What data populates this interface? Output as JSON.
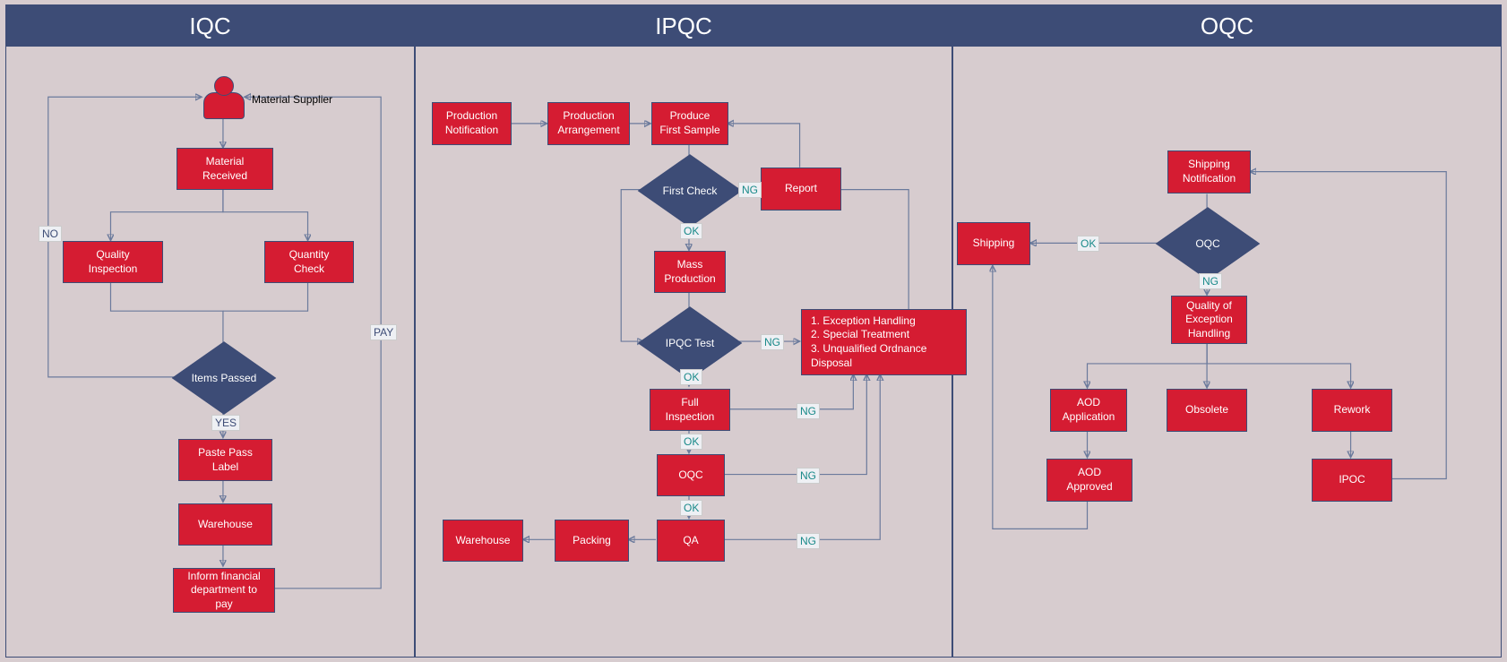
{
  "lanes": {
    "iqc": {
      "title": "IQC"
    },
    "ipqc": {
      "title": "IPQC"
    },
    "oqc": {
      "title": "OQC"
    }
  },
  "iqc": {
    "actor_label": "Material Supplier",
    "material_received": "Material Received",
    "quality_inspection": "Quality Inspection",
    "quantity_check": "Quantity Check",
    "items_passed": "Items Passed",
    "paste_pass_label": "Paste Pass Label",
    "warehouse": "Warehouse",
    "inform_pay": "Inform financial department to pay",
    "edge_no": "NO",
    "edge_yes": "YES",
    "edge_pay": "PAY"
  },
  "ipqc": {
    "production_notification": "Production Notification",
    "production_arrangement": "Production Arrangement",
    "produce_first_sample": "Produce First Sample",
    "first_check": "First Check",
    "report": "Report",
    "mass_production": "Mass Production",
    "ipqc_test": "IPQC Test",
    "exception_text": "1. Exception Handling\n2. Special Treatment\n3. Unqualified Ordnance Disposal",
    "full_inspection": "Full Inspection",
    "oqc": "OQC",
    "qa": "QA",
    "packing": "Packing",
    "warehouse": "Warehouse",
    "edge_ok": "OK",
    "edge_ng": "NG"
  },
  "oqc": {
    "shipping_notification": "Shipping Notification",
    "oqc_decision": "OQC",
    "shipping": "Shipping",
    "quality_exception": "Quality of Exception Handling",
    "aod_application": "AOD Application",
    "obsolete": "Obsolete",
    "rework": "Rework",
    "aod_approved": "AOD Approved",
    "ipoc": "IPOC",
    "edge_ok": "OK",
    "edge_ng": "NG"
  },
  "chart_data": {
    "type": "flowchart-swimlane",
    "swimlanes": [
      "IQC",
      "IPQC",
      "OQC"
    ],
    "nodes": [
      {
        "id": "supplier",
        "lane": "IQC",
        "type": "actor",
        "label": "Material Supplier"
      },
      {
        "id": "mat_received",
        "lane": "IQC",
        "type": "process",
        "label": "Material Received"
      },
      {
        "id": "qual_insp",
        "lane": "IQC",
        "type": "process",
        "label": "Quality Inspection"
      },
      {
        "id": "qty_check",
        "lane": "IQC",
        "type": "process",
        "label": "Quantity Check"
      },
      {
        "id": "items_passed",
        "lane": "IQC",
        "type": "decision",
        "label": "Items Passed"
      },
      {
        "id": "paste_label",
        "lane": "IQC",
        "type": "process",
        "label": "Paste Pass Label"
      },
      {
        "id": "warehouse1",
        "lane": "IQC",
        "type": "process",
        "label": "Warehouse"
      },
      {
        "id": "inform_pay",
        "lane": "IQC",
        "type": "process",
        "label": "Inform financial department to pay"
      },
      {
        "id": "prod_notif",
        "lane": "IPQC",
        "type": "process",
        "label": "Production Notification"
      },
      {
        "id": "prod_arr",
        "lane": "IPQC",
        "type": "process",
        "label": "Production Arrangement"
      },
      {
        "id": "first_sample",
        "lane": "IPQC",
        "type": "process",
        "label": "Produce First Sample"
      },
      {
        "id": "first_check",
        "lane": "IPQC",
        "type": "decision",
        "label": "First Check"
      },
      {
        "id": "report",
        "lane": "IPQC",
        "type": "process",
        "label": "Report"
      },
      {
        "id": "mass_prod",
        "lane": "IPQC",
        "type": "process",
        "label": "Mass Production"
      },
      {
        "id": "ipqc_test",
        "lane": "IPQC",
        "type": "decision",
        "label": "IPQC Test"
      },
      {
        "id": "exception",
        "lane": "IPQC",
        "type": "process",
        "label": "1. Exception Handling\n2. Special Treatment\n3. Unqualified Ordnance Disposal"
      },
      {
        "id": "full_insp",
        "lane": "IPQC",
        "type": "process",
        "label": "Full Inspection"
      },
      {
        "id": "oqc2",
        "lane": "IPQC",
        "type": "process",
        "label": "OQC"
      },
      {
        "id": "qa",
        "lane": "IPQC",
        "type": "process",
        "label": "QA"
      },
      {
        "id": "packing",
        "lane": "IPQC",
        "type": "process",
        "label": "Packing"
      },
      {
        "id": "warehouse2",
        "lane": "IPQC",
        "type": "process",
        "label": "Warehouse"
      },
      {
        "id": "ship_notif",
        "lane": "OQC",
        "type": "process",
        "label": "Shipping Notification"
      },
      {
        "id": "oqc_dec",
        "lane": "OQC",
        "type": "decision",
        "label": "OQC"
      },
      {
        "id": "shipping",
        "lane": "OQC",
        "type": "process",
        "label": "Shipping"
      },
      {
        "id": "qual_exc",
        "lane": "OQC",
        "type": "process",
        "label": "Quality of Exception Handling"
      },
      {
        "id": "aod_app",
        "lane": "OQC",
        "type": "process",
        "label": "AOD Application"
      },
      {
        "id": "obsolete",
        "lane": "OQC",
        "type": "process",
        "label": "Obsolete"
      },
      {
        "id": "rework",
        "lane": "OQC",
        "type": "process",
        "label": "Rework"
      },
      {
        "id": "aod_appr",
        "lane": "OQC",
        "type": "process",
        "label": "AOD Approved"
      },
      {
        "id": "ipoc",
        "lane": "OQC",
        "type": "process",
        "label": "IPOC"
      }
    ],
    "edges": [
      {
        "from": "supplier",
        "to": "mat_received"
      },
      {
        "from": "mat_received",
        "to": "qual_insp"
      },
      {
        "from": "mat_received",
        "to": "qty_check"
      },
      {
        "from": "qual_insp",
        "to": "items_passed"
      },
      {
        "from": "qty_check",
        "to": "items_passed"
      },
      {
        "from": "items_passed",
        "to": "supplier",
        "label": "NO"
      },
      {
        "from": "items_passed",
        "to": "paste_label",
        "label": "YES"
      },
      {
        "from": "paste_label",
        "to": "warehouse1"
      },
      {
        "from": "warehouse1",
        "to": "inform_pay"
      },
      {
        "from": "inform_pay",
        "to": "supplier",
        "label": "PAY"
      },
      {
        "from": "prod_notif",
        "to": "prod_arr"
      },
      {
        "from": "prod_arr",
        "to": "first_sample"
      },
      {
        "from": "first_sample",
        "to": "first_check"
      },
      {
        "from": "first_check",
        "to": "report",
        "label": "NG"
      },
      {
        "from": "report",
        "to": "first_sample"
      },
      {
        "from": "first_check",
        "to": "mass_prod",
        "label": "OK"
      },
      {
        "from": "mass_prod",
        "to": "ipqc_test"
      },
      {
        "from": "ipqc_test",
        "to": "exception",
        "label": "NG"
      },
      {
        "from": "ipqc_test",
        "to": "full_insp",
        "label": "OK"
      },
      {
        "from": "full_insp",
        "to": "exception",
        "label": "NG"
      },
      {
        "from": "full_insp",
        "to": "oqc2",
        "label": "OK"
      },
      {
        "from": "oqc2",
        "to": "exception",
        "label": "NG"
      },
      {
        "from": "oqc2",
        "to": "qa",
        "label": "OK"
      },
      {
        "from": "qa",
        "to": "exception",
        "label": "NG"
      },
      {
        "from": "qa",
        "to": "packing"
      },
      {
        "from": "packing",
        "to": "warehouse2"
      },
      {
        "from": "exception",
        "to": "first_check"
      },
      {
        "from": "ship_notif",
        "to": "oqc_dec"
      },
      {
        "from": "oqc_dec",
        "to": "shipping",
        "label": "OK"
      },
      {
        "from": "oqc_dec",
        "to": "qual_exc",
        "label": "NG"
      },
      {
        "from": "qual_exc",
        "to": "aod_app"
      },
      {
        "from": "qual_exc",
        "to": "obsolete"
      },
      {
        "from": "qual_exc",
        "to": "rework"
      },
      {
        "from": "aod_app",
        "to": "aod_appr"
      },
      {
        "from": "rework",
        "to": "ipoc"
      },
      {
        "from": "aod_appr",
        "to": "shipping"
      },
      {
        "from": "ipoc",
        "to": "ship_notif"
      }
    ]
  }
}
